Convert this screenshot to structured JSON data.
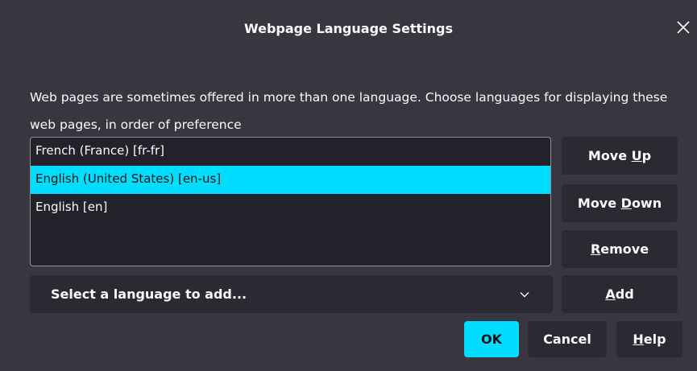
{
  "dialog": {
    "title": "Webpage Language Settings",
    "description": "Web pages are sometimes offered in more than one language. Choose languages for displaying these web pages, in order of preference"
  },
  "languages": [
    {
      "label": "French (France) [fr-fr]",
      "selected": false
    },
    {
      "label": "English (United States) [en-us]",
      "selected": true
    },
    {
      "label": "English [en]",
      "selected": false
    }
  ],
  "buttons": {
    "move_up": {
      "pre": "Move ",
      "key": "U",
      "post": "p"
    },
    "move_down": {
      "pre": "Move ",
      "key": "D",
      "post": "own"
    },
    "remove": {
      "pre": "",
      "key": "R",
      "post": "emove"
    },
    "add": {
      "pre": "",
      "key": "A",
      "post": "dd"
    },
    "ok": "OK",
    "cancel": "Cancel",
    "help": {
      "pre": "",
      "key": "H",
      "post": "elp"
    }
  },
  "select": {
    "label": "Select a language to add..."
  },
  "icons": {
    "close": "close-icon",
    "chevron": "chevron-down-icon"
  },
  "colors": {
    "background": "#38373f",
    "list_background": "#23222b",
    "button_background": "#2b2a33",
    "accent": "#00ddff",
    "text": "#fbfbfe"
  }
}
